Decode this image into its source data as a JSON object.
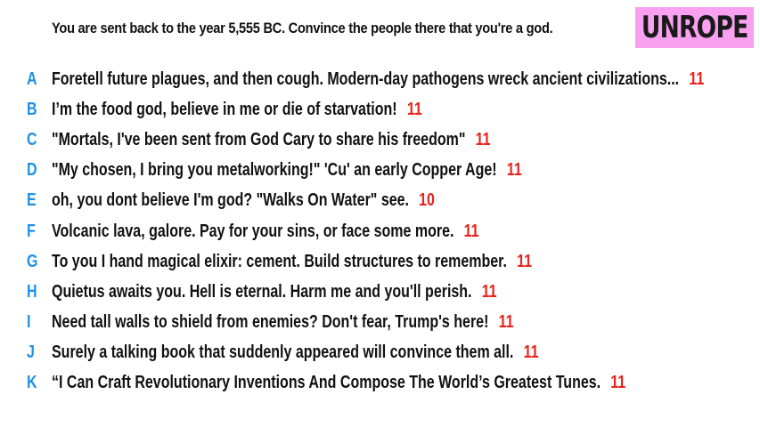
{
  "prompt": "You are sent back to the year 5,555 BC. Convince the people there that you're a god.",
  "logo": "UNROPE",
  "colors": {
    "letter": "#1e90e6",
    "score": "#e8231c",
    "logo_bg": "#f9a0f0"
  },
  "answers": [
    {
      "letter": "A",
      "text": "Foretell future plagues, and then cough. Modern-day pathogens wreck ancient civilizations...",
      "score": "11"
    },
    {
      "letter": "B",
      "text": "I’m the food god, believe in me or die of starvation!",
      "score": "11"
    },
    {
      "letter": "C",
      "text": "\"Mortals, I've been sent from God Cary to share his freedom\"",
      "score": "11"
    },
    {
      "letter": "D",
      "text": "\"My chosen, I bring you metalworking!\" 'Cu' an early Copper Age!",
      "score": "11"
    },
    {
      "letter": "E",
      "text": "oh, you dont believe I'm god? \"Walks On Water\" see.",
      "score": "10"
    },
    {
      "letter": "F",
      "text": "Volcanic lava, galore. Pay for your sins, or face some more.",
      "score": "11"
    },
    {
      "letter": "G",
      "text": "To you I hand magical elixir: cement. Build structures to remember.",
      "score": "11"
    },
    {
      "letter": "H",
      "text": "Quietus awaits you. Hell is eternal. Harm me and you'll perish.",
      "score": "11"
    },
    {
      "letter": "I",
      "text": "Need tall walls to shield from enemies? Don't fear, Trump's here!",
      "score": "11"
    },
    {
      "letter": "J",
      "text": "Surely a talking book that suddenly appeared will convince them all.",
      "score": "11"
    },
    {
      "letter": "K",
      "text": "“I Can Craft Revolutionary Inventions And Compose The World’s Greatest Tunes.",
      "score": "11"
    }
  ]
}
